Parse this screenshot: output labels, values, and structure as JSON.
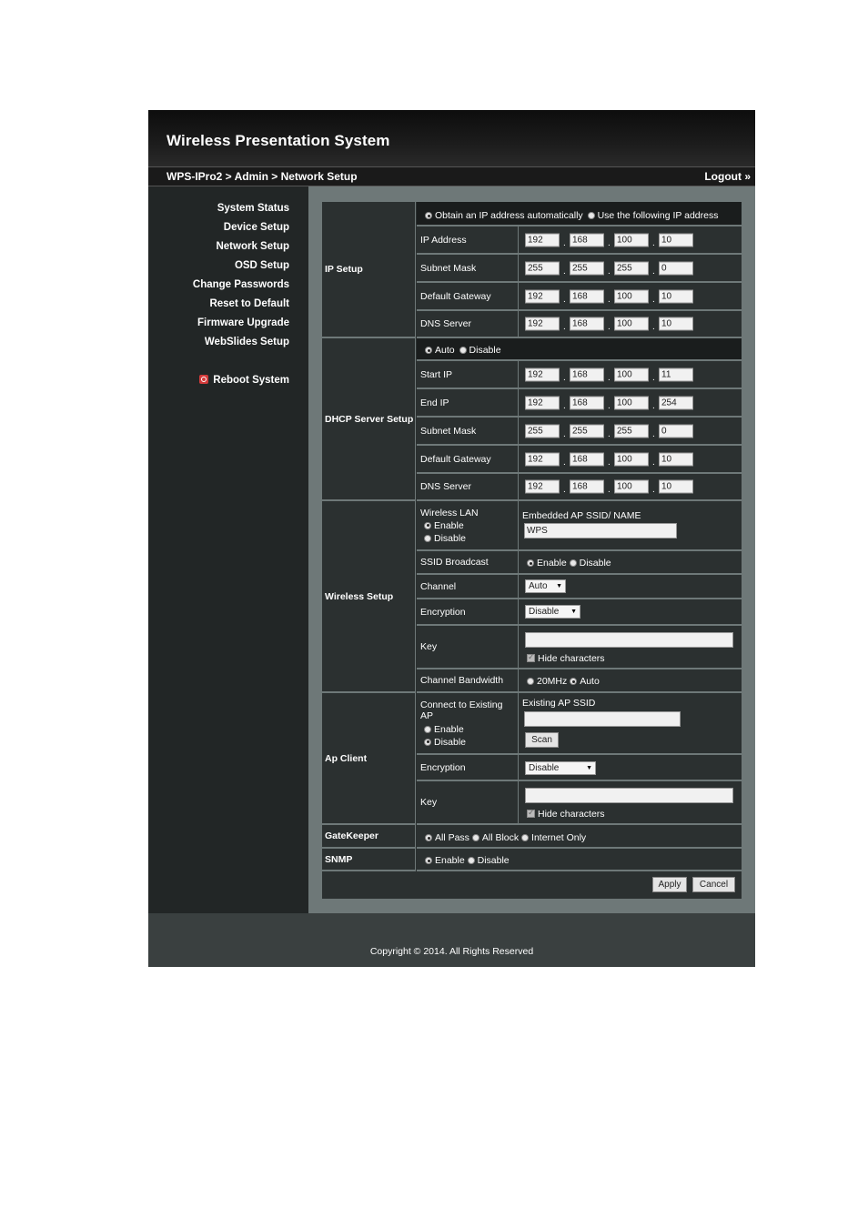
{
  "header": {
    "title": "Wireless Presentation System",
    "breadcrumb": "WPS-IPro2 > Admin > Network Setup",
    "logout": "Logout »"
  },
  "sidebar": {
    "items": [
      {
        "label": "System Status"
      },
      {
        "label": "Device Setup"
      },
      {
        "label": "Network Setup"
      },
      {
        "label": "OSD Setup"
      },
      {
        "label": "Change Passwords"
      },
      {
        "label": "Reset to Default"
      },
      {
        "label": "Firmware Upgrade"
      },
      {
        "label": "WebSlides Setup"
      }
    ],
    "reboot": "Reboot System"
  },
  "ip_setup": {
    "section": "IP Setup",
    "mode_auto": "Obtain an IP address automatically",
    "mode_manual": "Use the following IP address",
    "selected_mode": "auto",
    "rows": [
      {
        "label": "IP Address",
        "octets": [
          "192",
          "168",
          "100",
          "10"
        ]
      },
      {
        "label": "Subnet Mask",
        "octets": [
          "255",
          "255",
          "255",
          "0"
        ]
      },
      {
        "label": "Default Gateway",
        "octets": [
          "192",
          "168",
          "100",
          "10"
        ]
      },
      {
        "label": "DNS Server",
        "octets": [
          "192",
          "168",
          "100",
          "10"
        ]
      }
    ]
  },
  "dhcp": {
    "section": "DHCP Server Setup",
    "auto": "Auto",
    "disable": "Disable",
    "selected": "auto",
    "rows": [
      {
        "label": "Start IP",
        "octets": [
          "192",
          "168",
          "100",
          "11"
        ]
      },
      {
        "label": "End IP",
        "octets": [
          "192",
          "168",
          "100",
          "254"
        ]
      },
      {
        "label": "Subnet Mask",
        "octets": [
          "255",
          "255",
          "255",
          "0"
        ]
      },
      {
        "label": "Default Gateway",
        "octets": [
          "192",
          "168",
          "100",
          "10"
        ]
      },
      {
        "label": "DNS Server",
        "octets": [
          "192",
          "168",
          "100",
          "10"
        ]
      }
    ]
  },
  "wireless": {
    "section": "Wireless Setup",
    "wlan_label": "Wireless LAN",
    "wlan_enable": "Enable",
    "wlan_disable": "Disable",
    "ssid_label": "Embedded AP SSID/ NAME",
    "ssid_value": "WPS",
    "broadcast_label": "SSID Broadcast",
    "broadcast_enable": "Enable",
    "broadcast_disable": "Disable",
    "channel_label": "Channel",
    "channel_value": "Auto",
    "encryption_label": "Encryption",
    "encryption_value": "Disable",
    "key_label": "Key",
    "key_value": "",
    "hide_chars": "Hide characters",
    "bandwidth_label": "Channel Bandwidth",
    "bw_20": "20MHz",
    "bw_auto": "Auto"
  },
  "ap_client": {
    "section": "Ap Client",
    "connect_label": "Connect to Existing AP",
    "enable": "Enable",
    "disable": "Disable",
    "ssid_label": "Existing AP SSID",
    "ssid_value": "",
    "scan": "Scan",
    "encryption_label": "Encryption",
    "encryption_value": "Disable",
    "key_label": "Key",
    "key_value": "",
    "hide_chars": "Hide characters"
  },
  "gatekeeper": {
    "section": "GateKeeper",
    "all_pass": "All Pass",
    "all_block": "All Block",
    "internet_only": "Internet Only"
  },
  "snmp": {
    "section": "SNMP",
    "enable": "Enable",
    "disable": "Disable"
  },
  "actions": {
    "apply": "Apply",
    "cancel": "Cancel"
  },
  "footer": {
    "copyright": "Copyright © 2014. All Rights Reserved"
  }
}
